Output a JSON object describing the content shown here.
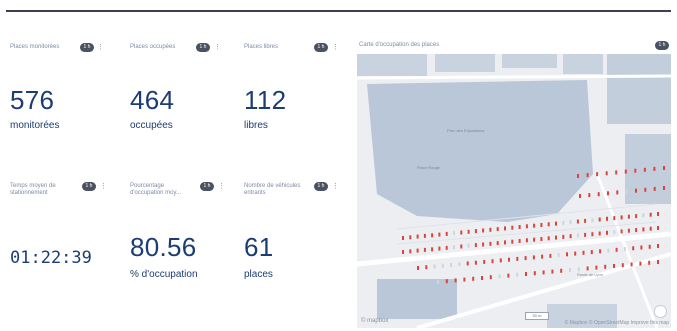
{
  "cards": [
    {
      "title": "Places monitorées",
      "badge": "1 h",
      "value": "576",
      "subtitle": "monitorées"
    },
    {
      "title": "Places occupées",
      "badge": "1 h",
      "value": "464",
      "subtitle": "occupées"
    },
    {
      "title": "Places libres",
      "badge": "1 h",
      "value": "112",
      "subtitle": "libres"
    },
    {
      "title": "Temps moyen de stationnement",
      "badge": "1 h",
      "value": "01:22:39",
      "subtitle": ""
    },
    {
      "title": "Pourcentage d'occupation moy...",
      "badge": "1 h",
      "value": "80.56",
      "subtitle": "% d'occupation"
    },
    {
      "title": "Nombre de véhicules entrants",
      "badge": "1 h",
      "value": "61",
      "subtitle": "places"
    }
  ],
  "map": {
    "title": "Carte d'occupation des places",
    "badge": "1 h",
    "logo": "© mapbox",
    "attribution": "© Mapbox © OpenStreetMap  Improve this map",
    "scale": "50 m",
    "labels": [
      "Parc des Expositions",
      "Place Rouge",
      "Route de Lyon"
    ]
  },
  "colors": {
    "occupied": "#d9453b",
    "free": "#cfd5de",
    "accent": "#1b3d72"
  }
}
